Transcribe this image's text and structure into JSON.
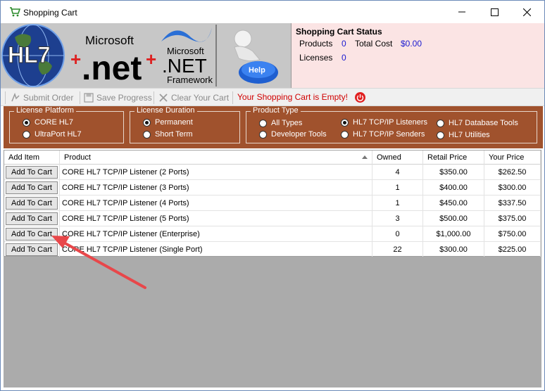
{
  "window": {
    "title": "Shopping Cart",
    "icon": "shopping-cart-icon"
  },
  "banner": {
    "logo_hl7": "HL7",
    "logo_net": ".net",
    "logo_microsoft": "Microsoft",
    "logo_net_framework_top": "Microsoft",
    "logo_net_framework_mid": ".NET",
    "logo_net_framework_bottom": "Framework",
    "help_label": "Help"
  },
  "cart_status": {
    "title": "Shopping Cart Status",
    "products_label": "Products",
    "products_value": "0",
    "total_cost_label": "Total Cost",
    "total_cost_value": "$0.00",
    "licenses_label": "Licenses",
    "licenses_value": "0"
  },
  "toolbar": {
    "submit_order": "Submit Order",
    "save_progress": "Save Progress",
    "clear_cart": "Clear Your Cart",
    "empty_message": "Your Shopping Cart is Empty!"
  },
  "filters": {
    "license_platform": {
      "title": "License Platform",
      "options": [
        "CORE HL7",
        "UltraPort HL7"
      ],
      "selected": "CORE HL7"
    },
    "license_duration": {
      "title": "License Duration",
      "options": [
        "Permanent",
        "Short Term"
      ],
      "selected": "Permanent"
    },
    "product_type": {
      "title": "Product Type",
      "options": [
        "All Types",
        "Developer Tools",
        "HL7 TCP/IP Listeners",
        "HL7 TCP/IP Senders",
        "HL7 Database Tools",
        "HL7 Utilities"
      ],
      "selected": "HL7 TCP/IP Listeners"
    }
  },
  "grid": {
    "columns": [
      "Add Item",
      "Product",
      "Owned",
      "Retail Price",
      "Your Price"
    ],
    "button_label": "Add To Cart",
    "rows": [
      {
        "product": "CORE HL7 TCP/IP Listener (2 Ports)",
        "owned": "4",
        "retail": "$350.00",
        "yours": "$262.50"
      },
      {
        "product": "CORE HL7 TCP/IP Listener (3 Ports)",
        "owned": "1",
        "retail": "$400.00",
        "yours": "$300.00"
      },
      {
        "product": "CORE HL7 TCP/IP Listener (4 Ports)",
        "owned": "1",
        "retail": "$450.00",
        "yours": "$337.50"
      },
      {
        "product": "CORE HL7 TCP/IP Listener (5 Ports)",
        "owned": "3",
        "retail": "$500.00",
        "yours": "$375.00"
      },
      {
        "product": "CORE HL7 TCP/IP Listener (Enterprise)",
        "owned": "0",
        "retail": "$1,000.00",
        "yours": "$750.00"
      },
      {
        "product": "CORE HL7 TCP/IP Listener (Single Port)",
        "owned": "22",
        "retail": "$300.00",
        "yours": "$225.00"
      }
    ]
  },
  "colors": {
    "filter_bar": "#a0522d",
    "status_panel": "#fbe4e4",
    "status_value": "#1a1ad0",
    "empty_message": "#d00000",
    "annotation_arrow": "#e8474a",
    "grid_background": "#ababab"
  }
}
